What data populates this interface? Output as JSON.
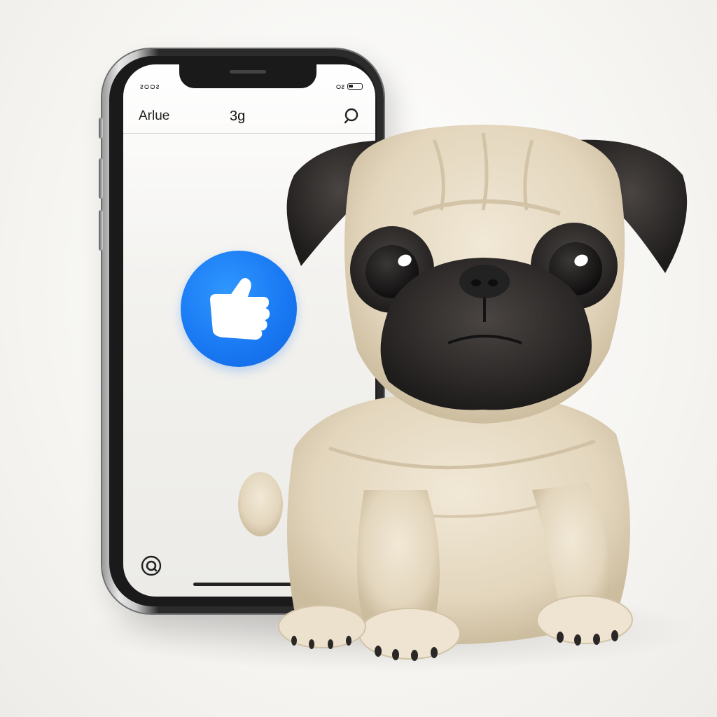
{
  "status_bar": {
    "left_text": "ᴤᴑᴑᴤ",
    "right_text": "ᴑᴤ"
  },
  "nav": {
    "left_label": "Arlue",
    "center_label": "3g",
    "search_icon": "search-icon"
  },
  "main": {
    "like_button_icon": "thumbs-up-icon",
    "like_button_color": "#1877f2"
  },
  "footer": {
    "bottom_icon": "search-icon"
  },
  "colors": {
    "accent": "#1877f2",
    "pug_fur": "#e9dfcb",
    "pug_dark": "#2f2c2a"
  }
}
